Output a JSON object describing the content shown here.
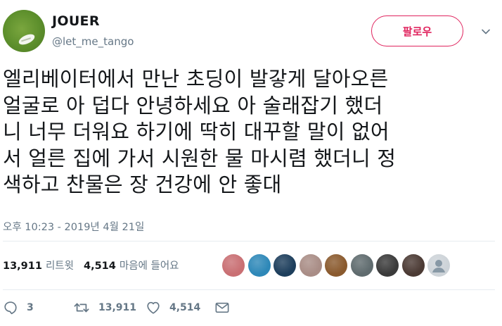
{
  "author": {
    "display_name": "JOUER",
    "handle": "@let_me_tango"
  },
  "follow_label": "팔로우",
  "tweet_text": "엘리베이터에서 만난 초딩이 발갛게 달아오른\n얼굴로 아 덥다 안녕하세요 아 술래잡기 했더\n니 너무 더워요 하기에 딱히 대꾸할 말이 없어\n서 얼른 집에 가서 시원한 물 마시렴 했더니 정\n색하고 찬물은 장 건강에 안 좋대",
  "timestamp": "오후 10:23 - 2019년 4월 21일",
  "stats": {
    "retweets": "13,911",
    "retweets_label": "리트윗",
    "likes": "4,514",
    "likes_label": "마음에 들어요"
  },
  "liker_avatar_colors": [
    "#c96f73",
    "#2e88b8",
    "#1d3e5c",
    "#a98d86",
    "#8a5a2e",
    "#5f6b6e",
    "#3a3a3a",
    "#4b3a34",
    "#cdd3d8"
  ],
  "actions": {
    "reply_count": "3",
    "retweet_count": "13,911",
    "like_count": "4,514"
  },
  "icons": {
    "reply": "speech-bubble",
    "retweet": "two-arrows-loop",
    "like": "heart-outline",
    "message": "envelope",
    "caret": "chevron-down"
  }
}
